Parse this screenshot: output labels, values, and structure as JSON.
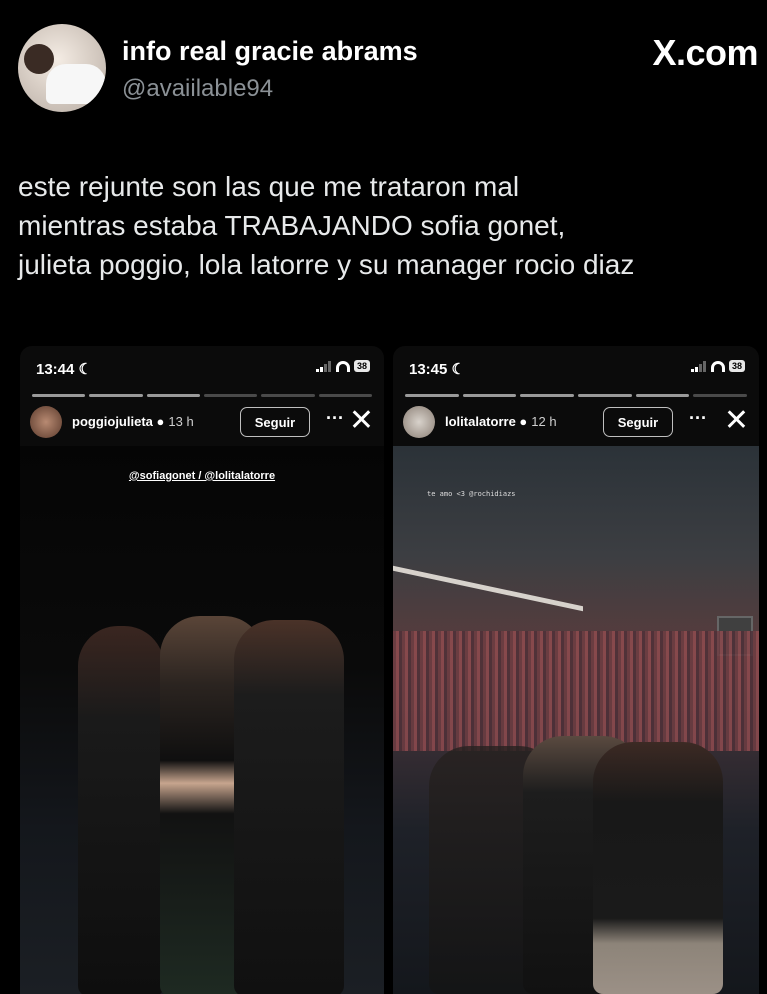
{
  "tweet": {
    "display_name": "info real gracie abrams",
    "handle": "@avaiilable94",
    "source": "X.com",
    "text_lines": [
      "este rejunte son las que me trataron mal",
      "mientras estaba TRABAJANDO sofia gonet,",
      "julieta poggio, lola latorre y su manager rocio diaz"
    ]
  },
  "stories": [
    {
      "time": "13:44",
      "battery": "38",
      "username": "poggiojulieta",
      "age": "13 h",
      "follow_label": "Seguir",
      "more": "···",
      "close": "✕",
      "caption": "@sofiagonet / @lolitalatorre"
    },
    {
      "time": "13:45",
      "battery": "38",
      "username": "lolitalatorre",
      "age": "12 h",
      "follow_label": "Seguir",
      "more": "···",
      "close": "✕",
      "caption": "te amo <3 @rochidiazs"
    }
  ],
  "colors": {
    "background": "#000000",
    "text": "#e7e9ea",
    "muted": "#8b9196"
  },
  "icons": [
    "moon-icon",
    "signal-icon",
    "wifi-icon",
    "battery-icon",
    "verified-icon",
    "close-icon",
    "more-icon"
  ]
}
